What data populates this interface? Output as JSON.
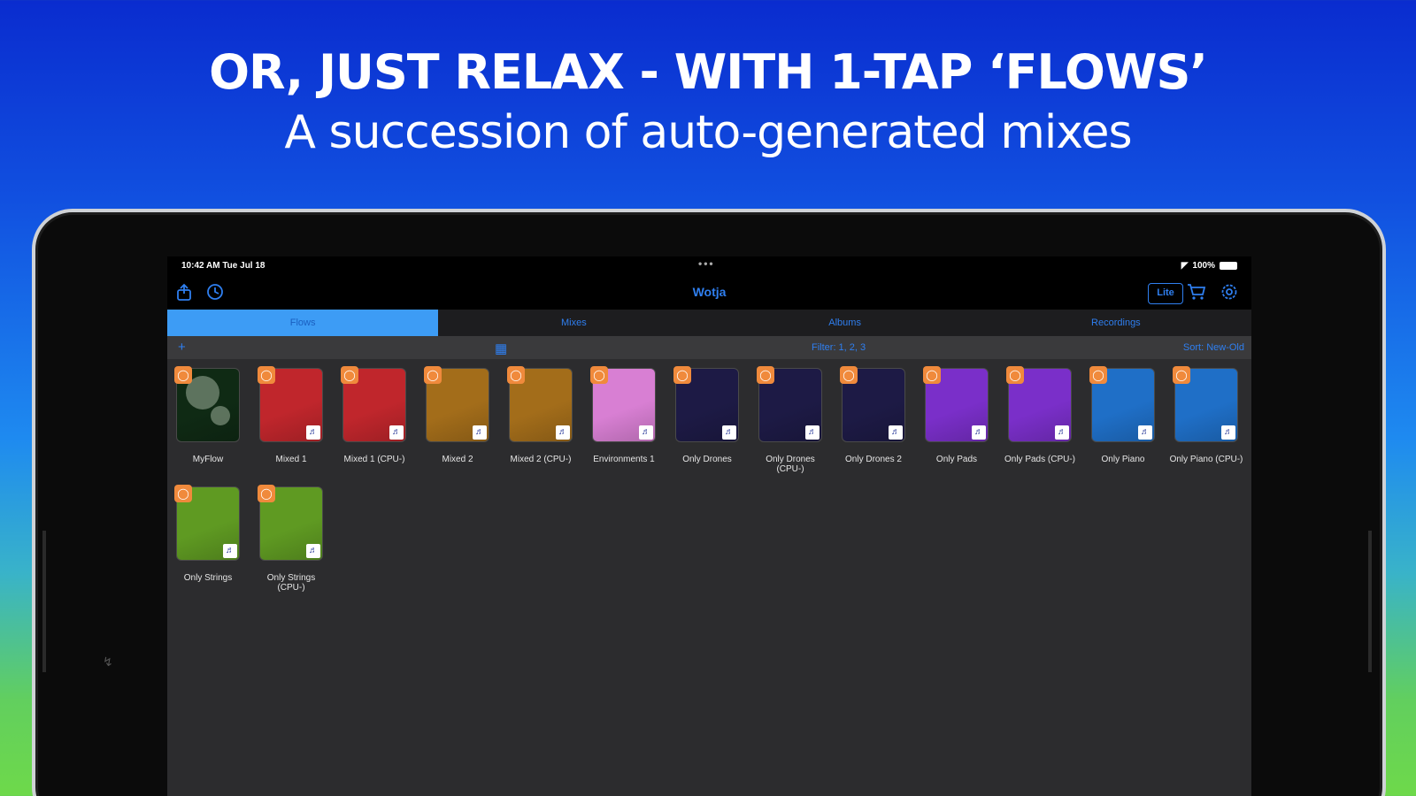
{
  "headline": {
    "line1": "OR, JUST RELAX - WITH 1-TAP ‘FLOWS’",
    "line2": "A succession of auto-generated mixes"
  },
  "status_bar": {
    "time_date": "10:42 AM   Tue Jul 18",
    "dots": "•••",
    "battery": "100%"
  },
  "nav": {
    "title": "Wotja",
    "lite_label": "Lite",
    "icons": [
      "share-icon",
      "history-icon",
      "cart-icon",
      "settings-icon"
    ]
  },
  "tabs": [
    {
      "label": "Flows",
      "active": true
    },
    {
      "label": "Mixes",
      "active": false
    },
    {
      "label": "Albums",
      "active": false
    },
    {
      "label": "Recordings",
      "active": false
    }
  ],
  "toolbar": {
    "add": "+",
    "filter": "Filter: 1, 2, 3",
    "sort": "Sort: New-Old"
  },
  "flows": [
    {
      "label": "MyFlow",
      "color": "#0f2a14"
    },
    {
      "label": "Mixed 1",
      "color": "#c0262c"
    },
    {
      "label": "Mixed 1 (CPU-)",
      "color": "#c0262c"
    },
    {
      "label": "Mixed 2",
      "color": "#a36d1a"
    },
    {
      "label": "Mixed 2 (CPU-)",
      "color": "#a36d1a"
    },
    {
      "label": "Environments 1",
      "color": "#d87fd3"
    },
    {
      "label": "Only Drones",
      "color": "#1d1a45"
    },
    {
      "label": "Only Drones (CPU-)",
      "color": "#1d1a45"
    },
    {
      "label": "Only Drones 2",
      "color": "#1d1a45"
    },
    {
      "label": "Only Pads",
      "color": "#7a2fc9"
    },
    {
      "label": "Only Pads (CPU-)",
      "color": "#7a2fc9"
    },
    {
      "label": "Only Piano",
      "color": "#1f6fc7"
    },
    {
      "label": "Only Piano (CPU-)",
      "color": "#1f6fc7"
    },
    {
      "label": "Only Strings",
      "color": "#5f9a22"
    },
    {
      "label": "Only Strings (CPU-)",
      "color": "#5f9a22"
    }
  ],
  "colors": {
    "accent": "#2f7ff0",
    "active_tab": "#3d9cf5",
    "badge": "#f08a3c"
  }
}
